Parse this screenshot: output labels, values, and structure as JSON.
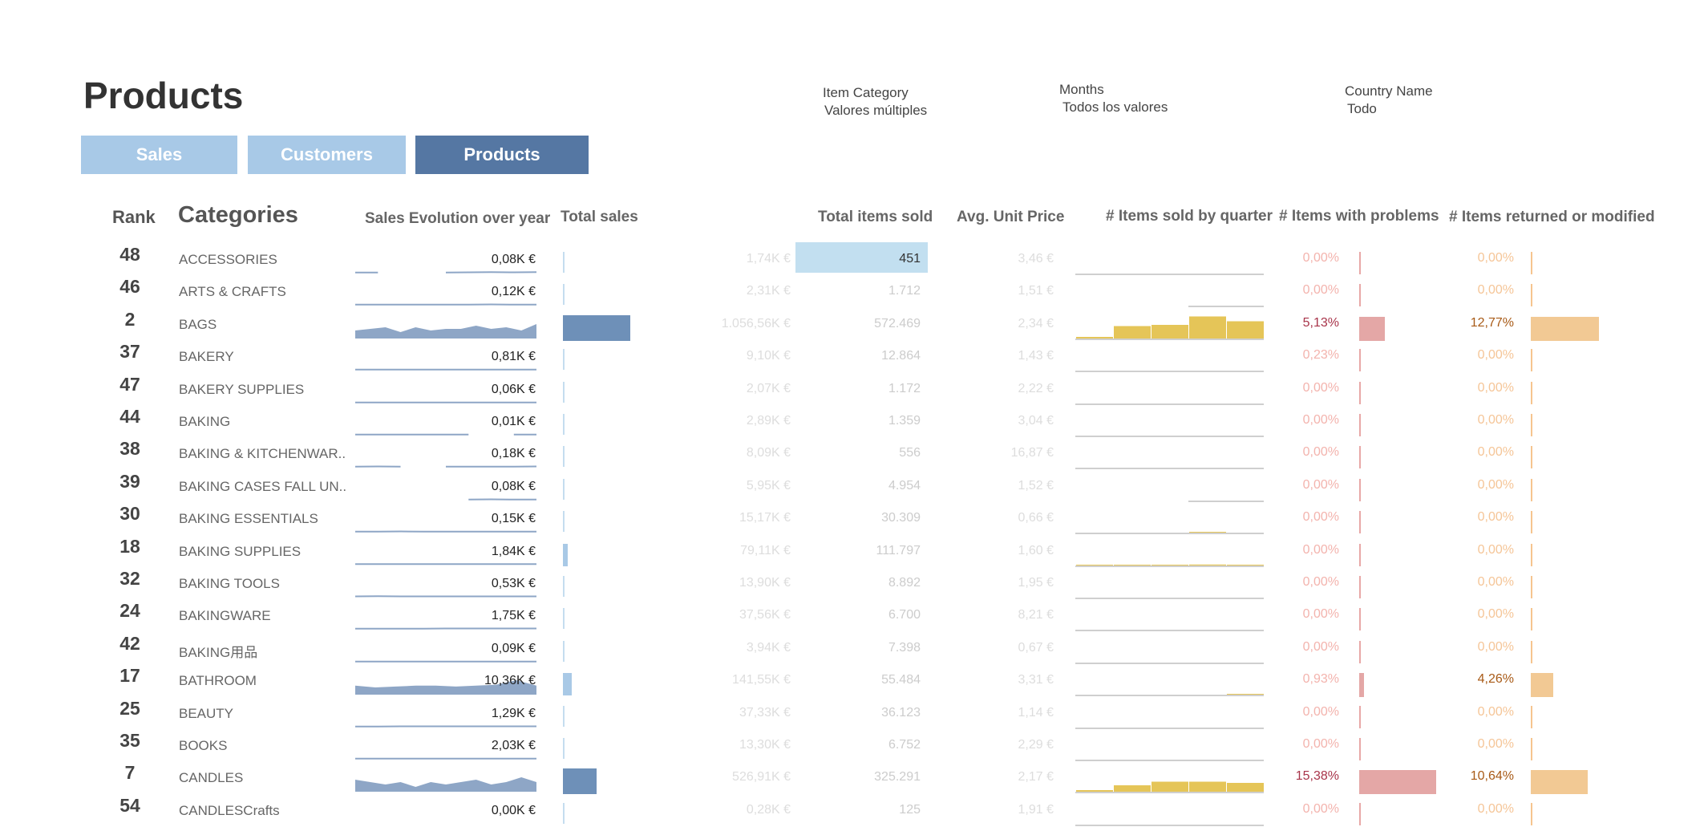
{
  "page": {
    "title": "Products"
  },
  "filters": [
    {
      "label": "Item Category",
      "value": "Valores múltiples"
    },
    {
      "label": "Months",
      "value": "Todos los valores"
    },
    {
      "label": "Country Name",
      "value": "Todo"
    }
  ],
  "tabs": [
    {
      "label": "Sales",
      "active": false
    },
    {
      "label": "Customers",
      "active": false
    },
    {
      "label": "Products",
      "active": true
    }
  ],
  "headers": {
    "rank": "Rank",
    "categories": "Categories",
    "sales_evolution": "Sales Evolution over year",
    "total_sales": "Total sales",
    "total_items_sold": "Total items sold",
    "avg_unit_price": "Avg. Unit Price",
    "items_by_quarter": "# Items sold by quarter",
    "items_with_problems": "# Items with problems",
    "items_returned": "# Items returned or modified"
  },
  "colors": {
    "tab_inactive": "#a8c9e7",
    "tab_active": "#5577a3",
    "sales_bar": "#6e90b8",
    "items_highlight": "#c2dff0",
    "quarter_bar": "#e5c558",
    "problems_bar": "#e4a7a6",
    "returned_bar": "#f2c994"
  },
  "rows": [
    {
      "rank": "48",
      "category": "ACCESSORIES",
      "total_label": "0,08K €",
      "total_sales_k": 1.74,
      "revenue": "1,74K €",
      "items": "451",
      "items_highlight": true,
      "price": "3,46 €",
      "problems": "0,00%",
      "problems_value": 0,
      "returned": "0,00%",
      "returned_value": 0,
      "quarters": [
        0,
        0,
        0,
        0,
        0
      ],
      "quarter_max": 0,
      "spark": [
        0.4,
        0.4,
        null,
        null,
        0.4,
        0.5,
        0.6,
        0.5,
        0.6
      ]
    },
    {
      "rank": "46",
      "category": "ARTS & CRAFTS",
      "total_label": "0,12K €",
      "total_sales_k": 2.31,
      "revenue": "2,31K €",
      "items": "1.712",
      "items_highlight": false,
      "price": "1,51 €",
      "problems": "0,00%",
      "problems_value": 0,
      "returned": "0,00%",
      "returned_value": 0,
      "quarters": [
        null,
        null,
        null,
        0,
        0
      ],
      "quarter_max": 0,
      "spark": [
        0.4,
        0.4,
        0.4,
        0.4,
        0.4,
        0.4,
        0.5,
        0.4,
        0.4
      ]
    },
    {
      "rank": "2",
      "category": "BAGS",
      "total_label": "",
      "total_sales_k": 1056.56,
      "revenue": "1.056,56K €",
      "items": "572.469",
      "items_highlight": false,
      "price": "2,34 €",
      "problems": "5,13%",
      "problems_value": 5.13,
      "returned": "12,77%",
      "returned_value": 12.77,
      "quarters": [
        2,
        11,
        12,
        19,
        15
      ],
      "quarter_max": 20,
      "spark": [
        5,
        6,
        7,
        4,
        7,
        5,
        6,
        6,
        8,
        6,
        7,
        5,
        9
      ],
      "spark_filled": true
    },
    {
      "rank": "37",
      "category": "BAKERY",
      "total_label": "0,81K €",
      "total_sales_k": 9.1,
      "revenue": "9,10K €",
      "items": "12.864",
      "items_highlight": false,
      "price": "1,43 €",
      "problems": "0,23%",
      "problems_value": 0.23,
      "returned": "0,00%",
      "returned_value": 0,
      "quarters": [
        0,
        0,
        0,
        0,
        0
      ],
      "quarter_max": 0,
      "spark": [
        0.4,
        0.4,
        0.4,
        0.4,
        0.4,
        0.4,
        0.4,
        0.4,
        0.4
      ]
    },
    {
      "rank": "47",
      "category": "BAKERY SUPPLIES",
      "total_label": "0,06K €",
      "total_sales_k": 2.07,
      "revenue": "2,07K €",
      "items": "1.172",
      "items_highlight": false,
      "price": "2,22 €",
      "problems": "0,00%",
      "problems_value": 0,
      "returned": "0,00%",
      "returned_value": 0,
      "quarters": [
        0,
        0,
        0,
        0,
        0
      ],
      "quarter_max": 0,
      "spark": [
        0.4,
        0.4,
        0.4,
        0.4,
        0.4,
        0.4,
        0.4,
        0.4,
        0.4
      ]
    },
    {
      "rank": "44",
      "category": "BAKING",
      "total_label": "0,01K €",
      "total_sales_k": 2.89,
      "revenue": "2,89K €",
      "items": "1.359",
      "items_highlight": false,
      "price": "3,04 €",
      "problems": "0,00%",
      "problems_value": 0,
      "returned": "0,00%",
      "returned_value": 0,
      "quarters": [
        0,
        0,
        0,
        0,
        0
      ],
      "quarter_max": 0,
      "spark": [
        0.4,
        0.4,
        0.4,
        0.4,
        0.4,
        0.4,
        null,
        0.4,
        0.4
      ]
    },
    {
      "rank": "38",
      "category": "BAKING & KITCHENWAR..",
      "total_label": "0,18K €",
      "total_sales_k": 8.09,
      "revenue": "8,09K €",
      "items": "556",
      "items_highlight": false,
      "price": "16,87 €",
      "problems": "0,00%",
      "problems_value": 0,
      "returned": "0,00%",
      "returned_value": 0,
      "quarters": [
        0,
        0,
        0,
        0,
        0
      ],
      "quarter_max": 0,
      "spark": [
        0.4,
        0.5,
        0.4,
        null,
        0.4,
        0.4,
        0.4,
        0.4,
        0.5
      ]
    },
    {
      "rank": "39",
      "category": "BAKING CASES FALL UN..",
      "total_label": "0,08K €",
      "total_sales_k": 5.95,
      "revenue": "5,95K €",
      "items": "4.954",
      "items_highlight": false,
      "price": "1,52 €",
      "problems": "0,00%",
      "problems_value": 0,
      "returned": "0,00%",
      "returned_value": 0,
      "quarters": [
        null,
        null,
        null,
        0,
        0
      ],
      "quarter_max": 0,
      "spark": [
        null,
        null,
        null,
        null,
        null,
        0.4,
        0.5,
        0.4,
        0.4
      ]
    },
    {
      "rank": "30",
      "category": "BAKING ESSENTIALS",
      "total_label": "0,15K €",
      "total_sales_k": 15.17,
      "revenue": "15,17K €",
      "items": "30.309",
      "items_highlight": false,
      "price": "0,66 €",
      "problems": "0,00%",
      "problems_value": 0,
      "returned": "0,00%",
      "returned_value": 0,
      "quarters": [
        0,
        0,
        0,
        0.2,
        0
      ],
      "quarter_max": 10,
      "spark": [
        0.4,
        0.4,
        0.5,
        0.4,
        0.4,
        0.4,
        0.4,
        0.4,
        0.4
      ]
    },
    {
      "rank": "18",
      "category": "BAKING SUPPLIES",
      "total_label": "1,84K €",
      "total_sales_k": 79.11,
      "revenue": "79,11K €",
      "items": "111.797",
      "items_highlight": false,
      "price": "1,60 €",
      "problems": "0,00%",
      "problems_value": 0,
      "returned": "0,00%",
      "returned_value": 0,
      "quarters": [
        0.3,
        0.8,
        1,
        1.5,
        0.8
      ],
      "quarter_max": 20,
      "spark": [
        0.6,
        0.6,
        0.6,
        0.6,
        0.6,
        0.6,
        0.6,
        0.6,
        0.6
      ]
    },
    {
      "rank": "32",
      "category": "BAKING TOOLS",
      "total_label": "0,53K €",
      "total_sales_k": 13.9,
      "revenue": "13,90K €",
      "items": "8.892",
      "items_highlight": false,
      "price": "1,95 €",
      "problems": "0,00%",
      "problems_value": 0,
      "returned": "0,00%",
      "returned_value": 0,
      "quarters": [
        0,
        0,
        0,
        0,
        0
      ],
      "quarter_max": 0,
      "spark": [
        0.5,
        0.6,
        0.5,
        0.5,
        0.5,
        0.5,
        0.5,
        0.5,
        0.5
      ]
    },
    {
      "rank": "24",
      "category": "BAKINGWARE",
      "total_label": "1,75K €",
      "total_sales_k": 37.56,
      "revenue": "37,56K €",
      "items": "6.700",
      "items_highlight": false,
      "price": "8,21 €",
      "problems": "0,00%",
      "problems_value": 0,
      "returned": "0,00%",
      "returned_value": 0,
      "quarters": [
        0,
        0,
        0,
        0,
        0
      ],
      "quarter_max": 0,
      "spark": [
        0.4,
        0.4,
        0.4,
        0.4,
        0.5,
        0.5,
        0.5,
        0.5,
        0.5
      ]
    },
    {
      "rank": "42",
      "category": "BAKING用品",
      "total_label": "0,09K €",
      "total_sales_k": 3.94,
      "revenue": "3,94K €",
      "items": "7.398",
      "items_highlight": false,
      "price": "0,67 €",
      "problems": "0,00%",
      "problems_value": 0,
      "returned": "0,00%",
      "returned_value": 0,
      "quarters": [
        0,
        0,
        0,
        0,
        0
      ],
      "quarter_max": 0,
      "spark": [
        0.4,
        0.4,
        0.4,
        0.4,
        0.4,
        0.4,
        0.4,
        0.4,
        0.4
      ]
    },
    {
      "rank": "17",
      "category": "BATHROOM",
      "total_label": "10,36K €",
      "total_sales_k": 141.55,
      "revenue": "141,55K €",
      "items": "55.484",
      "items_highlight": false,
      "price": "3,31 €",
      "problems": "0,93%",
      "problems_value": 0.93,
      "returned": "4,26%",
      "returned_value": 4.26,
      "quarters": [
        0,
        0,
        0,
        0,
        0.8
      ],
      "quarter_max": 20,
      "spark": [
        1,
        0.8,
        0.9,
        1,
        1,
        0.9,
        1,
        1.1,
        1.6,
        1
      ],
      "spark_filled": true
    },
    {
      "rank": "25",
      "category": "BEAUTY",
      "total_label": "1,29K €",
      "total_sales_k": 37.33,
      "revenue": "37,33K €",
      "items": "36.123",
      "items_highlight": false,
      "price": "1,14 €",
      "problems": "0,00%",
      "problems_value": 0,
      "returned": "0,00%",
      "returned_value": 0,
      "quarters": [
        0,
        0,
        0,
        0,
        0
      ],
      "quarter_max": 0,
      "spark": [
        0.4,
        0.4,
        0.5,
        0.5,
        0.5,
        0.5,
        0.5,
        0.5,
        0.5
      ]
    },
    {
      "rank": "35",
      "category": "BOOKS",
      "total_label": "2,03K €",
      "total_sales_k": 13.3,
      "revenue": "13,30K €",
      "items": "6.752",
      "items_highlight": false,
      "price": "2,29 €",
      "problems": "0,00%",
      "problems_value": 0,
      "returned": "0,00%",
      "returned_value": 0,
      "quarters": [
        0,
        0,
        0,
        0,
        0
      ],
      "quarter_max": 0,
      "spark": [
        0.4,
        0.4,
        0.4,
        0.4,
        0.4,
        0.4,
        0.4,
        0.4,
        0.4
      ]
    },
    {
      "rank": "7",
      "category": "CANDLES",
      "total_label": "",
      "total_sales_k": 526.91,
      "revenue": "526,91K €",
      "items": "325.291",
      "items_highlight": false,
      "price": "2,17 €",
      "problems": "15,38%",
      "problems_value": 15.38,
      "returned": "10,64%",
      "returned_value": 10.64,
      "quarters": [
        2,
        6,
        9,
        9,
        8
      ],
      "quarter_max": 20,
      "spark": [
        5,
        4,
        3,
        4,
        2,
        4,
        3,
        4,
        5,
        3,
        4,
        6,
        4
      ],
      "spark_filled": true
    },
    {
      "rank": "54",
      "category": "CANDLESCrafts",
      "total_label": "0,00K €",
      "total_sales_k": 0.28,
      "revenue": "0,28K €",
      "items": "125",
      "items_highlight": false,
      "price": "1,91 €",
      "problems": "0,00%",
      "problems_value": 0,
      "returned": "0,00%",
      "returned_value": 0,
      "quarters": [
        0,
        0,
        0,
        0,
        0
      ],
      "quarter_max": 0,
      "spark": []
    }
  ]
}
